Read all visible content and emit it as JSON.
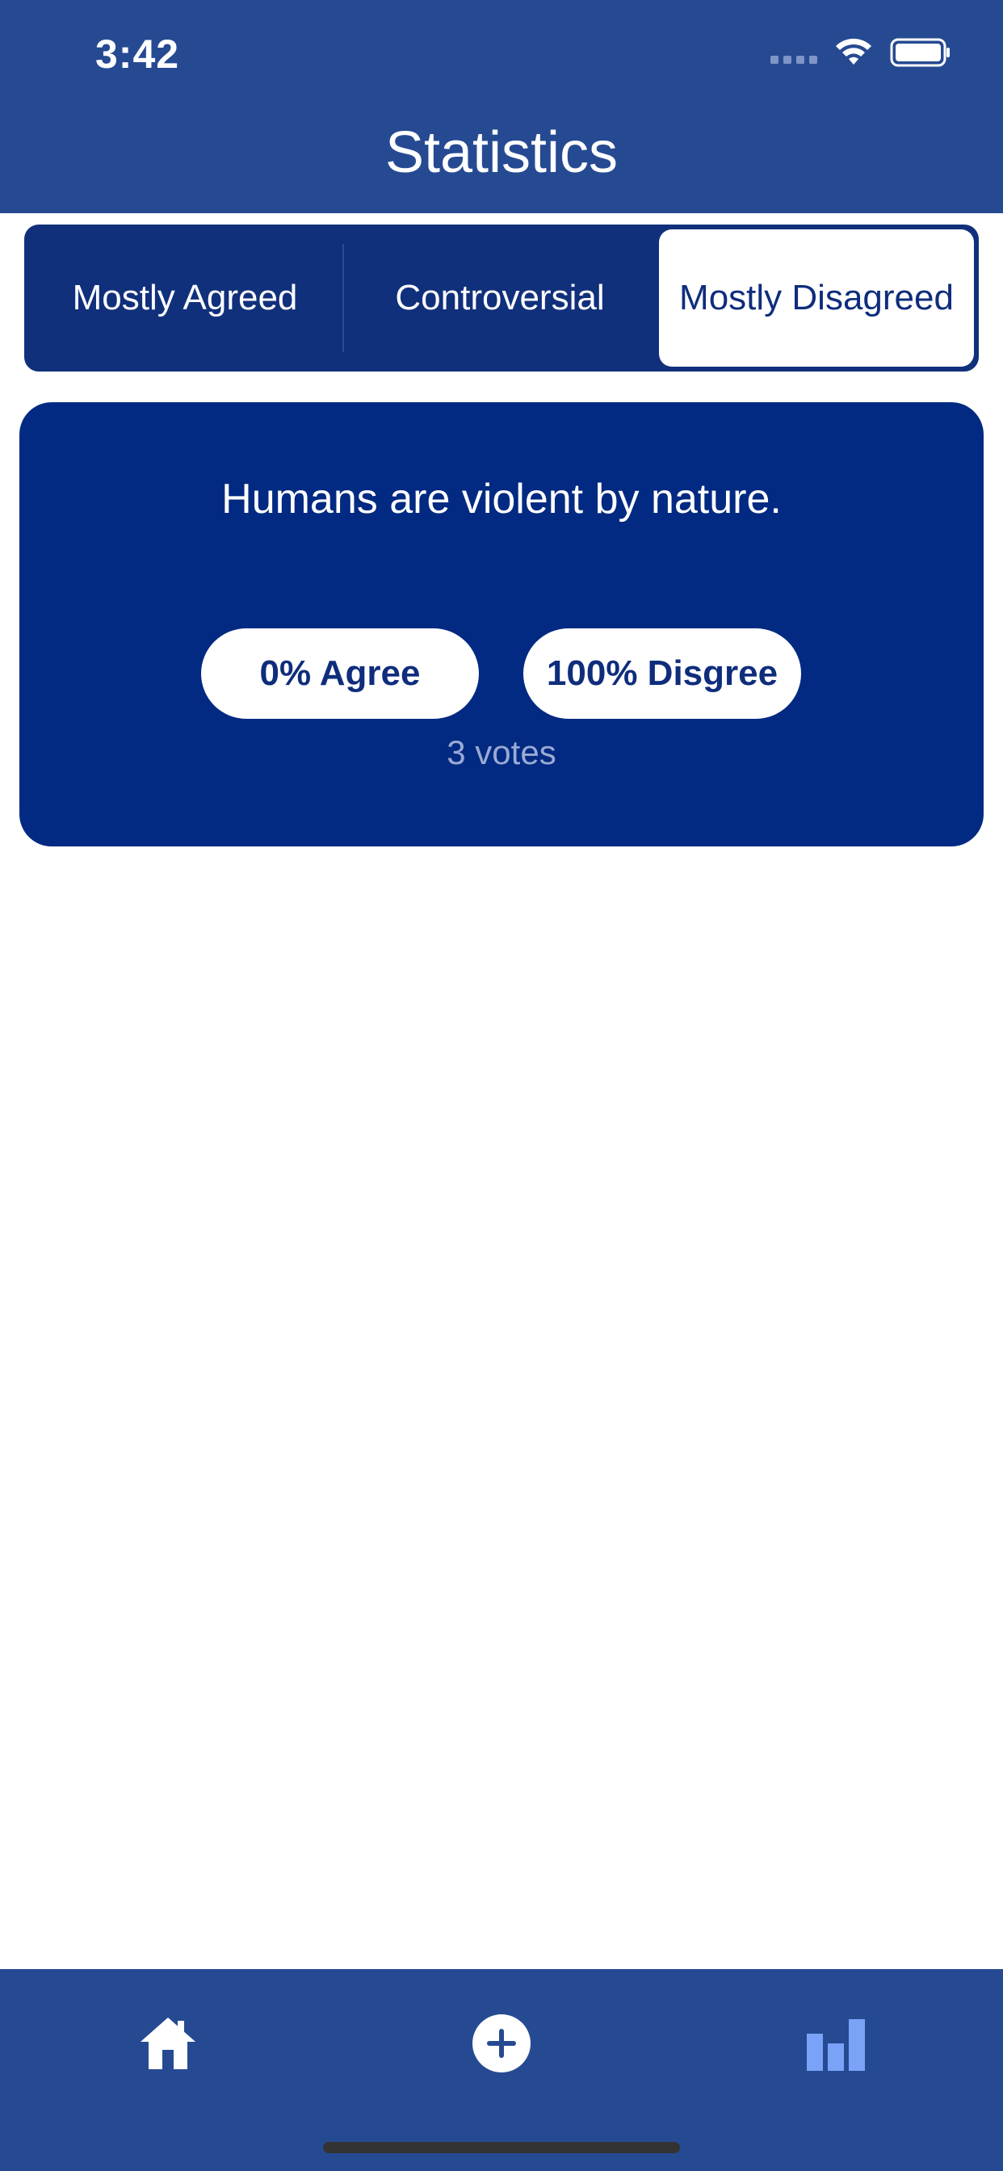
{
  "status_bar": {
    "time": "3:42"
  },
  "header": {
    "title": "Statistics"
  },
  "segments": [
    {
      "label": "Mostly Agreed"
    },
    {
      "label": "Controversial"
    },
    {
      "label": "Mostly Disagreed"
    }
  ],
  "card": {
    "statement": "Humans are violent by nature.",
    "agree_label": "0% Agree",
    "disagree_label": "100% Disgree",
    "votes": "3 votes"
  },
  "tabbar": {
    "icons": [
      "home-icon",
      "add-circle-icon",
      "bar-chart-icon"
    ]
  },
  "colors": {
    "header": "#264a92",
    "segment_bg": "#11307c",
    "card": "#022a82",
    "active_tab_icon": "#7aa2f7"
  }
}
